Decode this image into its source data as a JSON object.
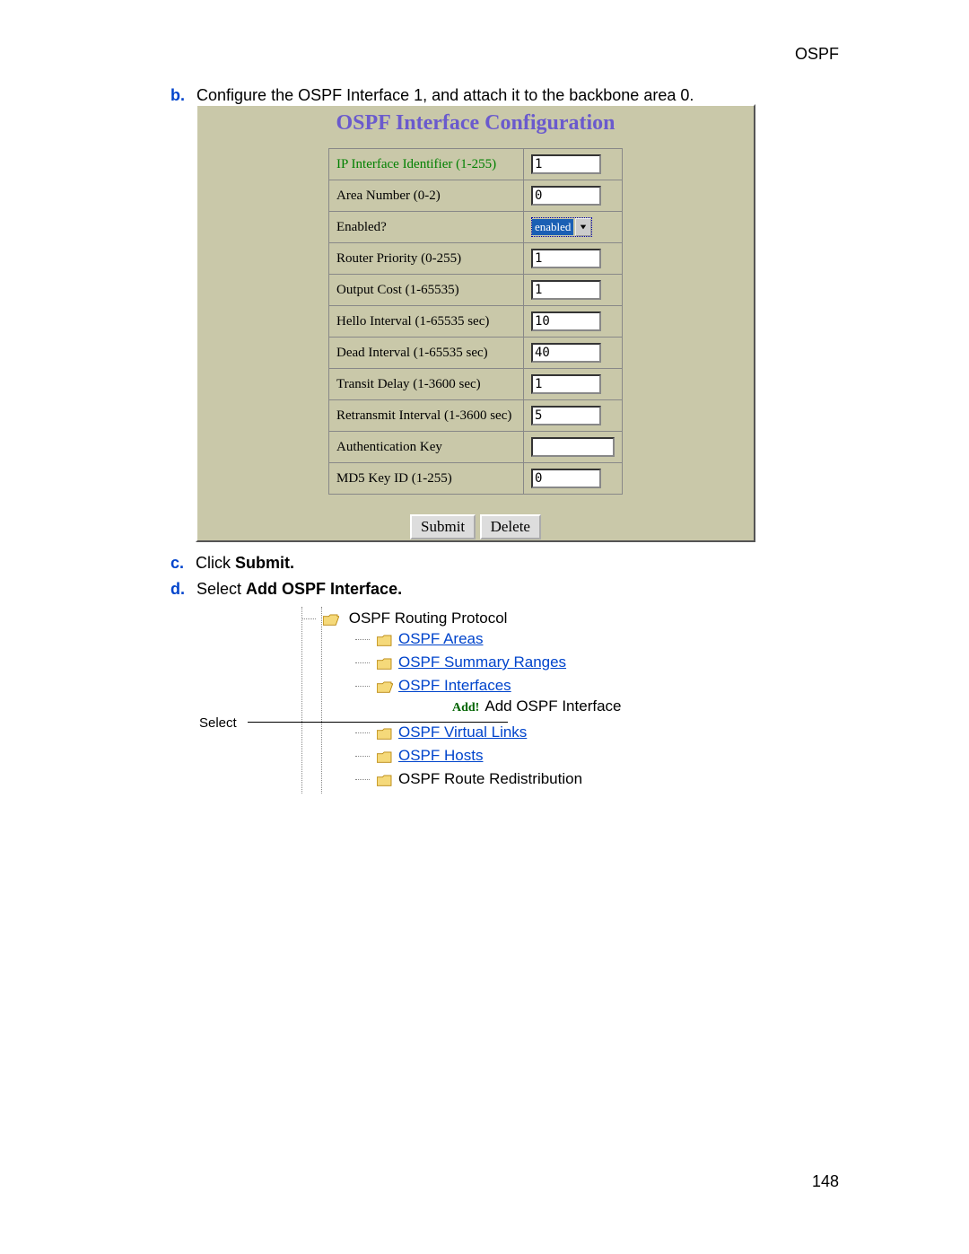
{
  "header": "OSPF",
  "page_number": "148",
  "steps": {
    "b": {
      "letter": "b.",
      "text": "Configure the OSPF Interface 1, and attach it to the backbone area 0."
    },
    "c": {
      "letter": "c.",
      "text_prefix": "Click ",
      "text_bold": "Submit."
    },
    "d": {
      "letter": "d.",
      "text_prefix": "Select ",
      "text_bold": "Add OSPF Interface."
    }
  },
  "panel": {
    "title": "OSPF Interface Configuration",
    "fields": [
      {
        "label": "IP Interface Identifier  (1-255)",
        "value": "1",
        "kind": "text",
        "ip": true
      },
      {
        "label": "Area Number  (0-2)",
        "value": "0",
        "kind": "text"
      },
      {
        "label": "Enabled?",
        "value": "enabled",
        "kind": "select"
      },
      {
        "label": "Router Priority (0-255)",
        "value": "1",
        "kind": "text"
      },
      {
        "label": "Output Cost (1-65535)",
        "value": "1",
        "kind": "text"
      },
      {
        "label": "Hello Interval (1-65535 sec)",
        "value": "10",
        "kind": "text"
      },
      {
        "label": "Dead Interval (1-65535 sec)",
        "value": "40",
        "kind": "text"
      },
      {
        "label": "Transit Delay (1-3600 sec)",
        "value": "1",
        "kind": "text"
      },
      {
        "label": "Retransmit Interval (1-3600 sec)",
        "value": "5",
        "kind": "text"
      },
      {
        "label": "Authentication Key",
        "value": "",
        "kind": "text",
        "wide": true
      },
      {
        "label": "MD5 Key ID (1-255)",
        "value": "0",
        "kind": "text"
      }
    ],
    "submit": "Submit",
    "delete": "Delete"
  },
  "tree": {
    "select_label": "Select",
    "root": "OSPF Routing Protocol",
    "items": [
      {
        "label": "OSPF Areas",
        "link": true
      },
      {
        "label": "OSPF Summary Ranges",
        "link": true
      },
      {
        "label": "OSPF Interfaces",
        "link": true,
        "open": true,
        "children": [
          {
            "add_label": "Add!",
            "label": "Add OSPF Interface",
            "link": false
          }
        ]
      },
      {
        "label": "OSPF Virtual Links",
        "link": true
      },
      {
        "label": "OSPF Hosts",
        "link": true
      },
      {
        "label": "OSPF Route Redistribution",
        "link": false
      }
    ]
  }
}
